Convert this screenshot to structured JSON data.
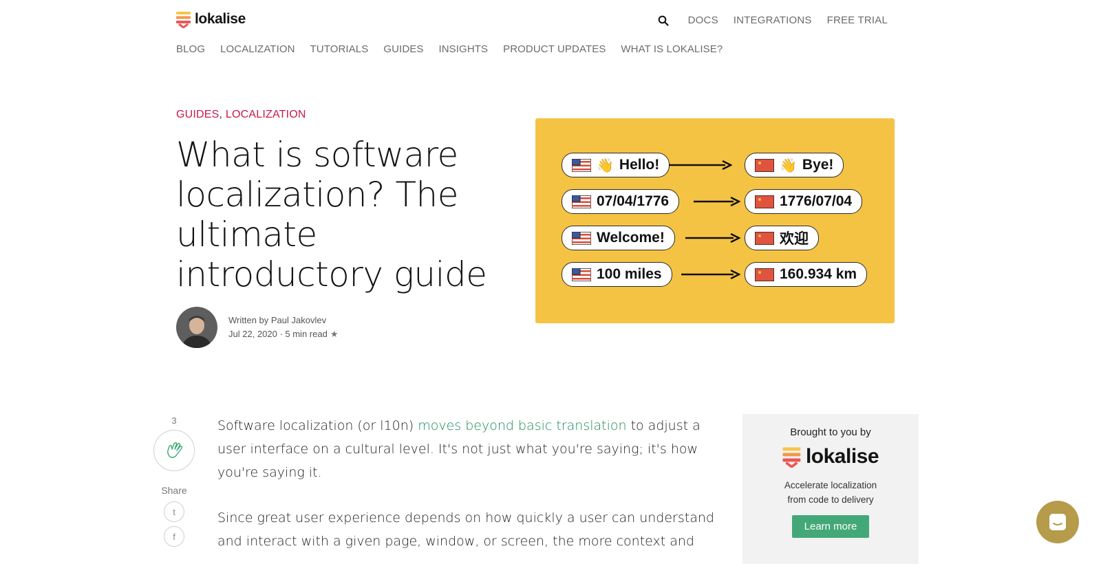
{
  "header": {
    "logo_text": "lokalise",
    "top_nav": [
      "DOCS",
      "INTEGRATIONS",
      "FREE TRIAL"
    ],
    "sub_nav": [
      "BLOG",
      "LOCALIZATION",
      "TUTORIALS",
      "GUIDES",
      "INSIGHTS",
      "PRODUCT UPDATES",
      "WHAT IS LOKALISE?"
    ]
  },
  "post": {
    "categories": [
      "GUIDES",
      "LOCALIZATION"
    ],
    "category_separator": ",",
    "title": "What is software localization? The ultimate introductory guide",
    "author_line": "Written by Paul Jakovlev",
    "date_line": "Jul 22, 2020 · 5 min read",
    "star": "★"
  },
  "hero_image": {
    "rows": [
      {
        "from": "Hello!",
        "to": "Bye!",
        "wave": true
      },
      {
        "from": "07/04/1776",
        "to": "1776/07/04",
        "wave": false
      },
      {
        "from": "Welcome!",
        "to": "欢迎",
        "wave": false
      },
      {
        "from": "100 miles",
        "to": "160.934 km",
        "wave": false
      }
    ],
    "wave_glyph": "👋",
    "background": "#f5c344",
    "from_flag": "us-flag-icon",
    "to_flag": "china-flag-icon"
  },
  "rail": {
    "clap_count": "3",
    "share_label": "Share",
    "twitter_glyph": "t",
    "facebook_glyph": "f"
  },
  "article": {
    "p1_before": "Software localization (or l10n) ",
    "p1_link": "moves beyond basic translation",
    "p1_after": " to adjust a user interface on a cultural level. It's not just what you're saying; it's how you're saying it.",
    "p2": "Since great user experience depends on how quickly a user can understand and interact with a given page, window, or screen,  the more context and"
  },
  "sponsor": {
    "brought_by": "Brought to you by",
    "logo_text": "lokalise",
    "tagline_1": "Accelerate localization",
    "tagline_2": "from code to delivery",
    "button": "Learn more"
  },
  "colors": {
    "accent_pink": "#c9184a",
    "link_green": "#1a8a5a",
    "button_green": "#43a877",
    "chat_bubble": "#b59b4a"
  }
}
